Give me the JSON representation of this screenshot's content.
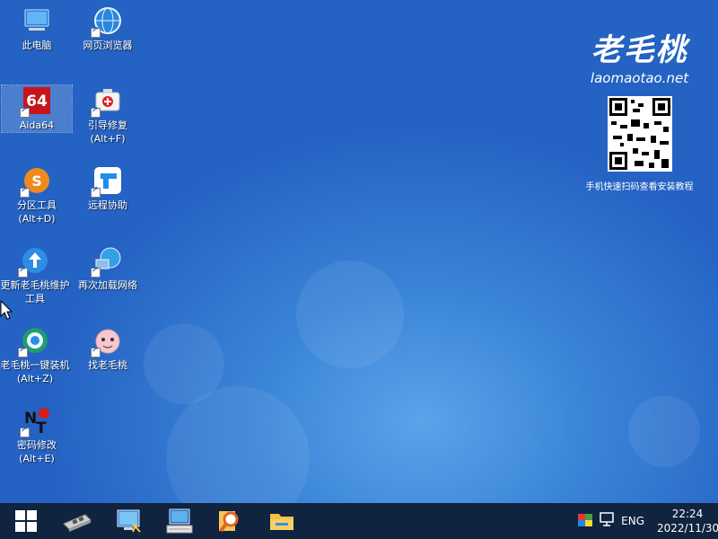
{
  "desktop": {
    "icons": [
      {
        "label": "此电脑",
        "icon": "computer-icon"
      },
      {
        "label": "网页浏览器",
        "icon": "web-browser-icon"
      },
      {
        "label": "Aida64",
        "icon": "aida64-icon"
      },
      {
        "label": "引导修复\n(Alt+F)",
        "icon": "boot-repair-icon"
      },
      {
        "label": "分区工具\n(Alt+D)",
        "icon": "partition-tool-icon"
      },
      {
        "label": "远程协助",
        "icon": "remote-assist-icon"
      },
      {
        "label": "更新老毛桃维护工具",
        "icon": "update-tool-icon"
      },
      {
        "label": "再次加载网络",
        "icon": "reload-network-icon"
      },
      {
        "label": "老毛桃一键装机(Alt+Z)",
        "icon": "one-click-install-icon"
      },
      {
        "label": "找老毛桃",
        "icon": "find-laomaotao-icon"
      },
      {
        "label": "密码修改\n(Alt+E)",
        "icon": "password-change-icon"
      }
    ]
  },
  "brand": {
    "logo_text": "老毛桃",
    "domain": "laomaotao.net",
    "qr_caption": "手机快速扫码查看安装教程"
  },
  "taskbar": {
    "apps": [
      "start-icon",
      "memory-chip-icon",
      "network-computer-icon",
      "keyboard-monitor-icon",
      "search-magnifier-icon",
      "file-explorer-icon"
    ],
    "language": "ENG",
    "time": "22:24",
    "date": "2022/11/30"
  }
}
